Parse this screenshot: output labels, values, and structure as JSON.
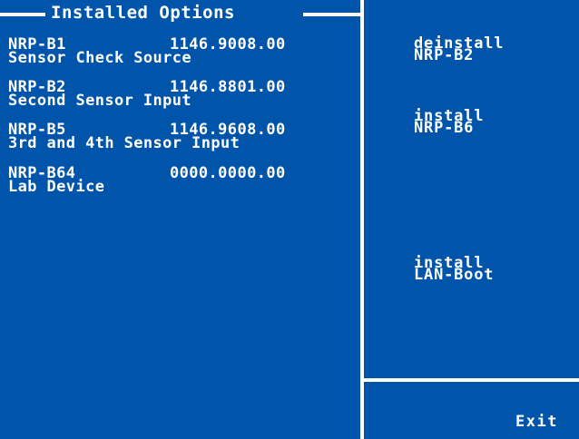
{
  "header": {
    "title": "Installed Options"
  },
  "options": [
    {
      "name": "NRP-B1",
      "code": "1146.9008.00",
      "desc": "Sensor Check Source"
    },
    {
      "name": "NRP-B2",
      "code": "1146.8801.00",
      "desc": "Second Sensor Input"
    },
    {
      "name": "NRP-B5",
      "code": "1146.9608.00",
      "desc": "3rd and 4th Sensor Input"
    },
    {
      "name": "NRP-B64",
      "code": "0000.0000.00",
      "desc": "Lab Device"
    }
  ],
  "softkeys": [
    {
      "line1": "deinstall",
      "line2": "NRP-B2"
    },
    {
      "line1": "install",
      "line2": "NRP-B6"
    },
    {
      "line1": "install",
      "line2": "LAN-Boot"
    }
  ],
  "exit_label": "Exit",
  "colors": {
    "background": "#0055aa",
    "foreground": "#ffffff"
  }
}
